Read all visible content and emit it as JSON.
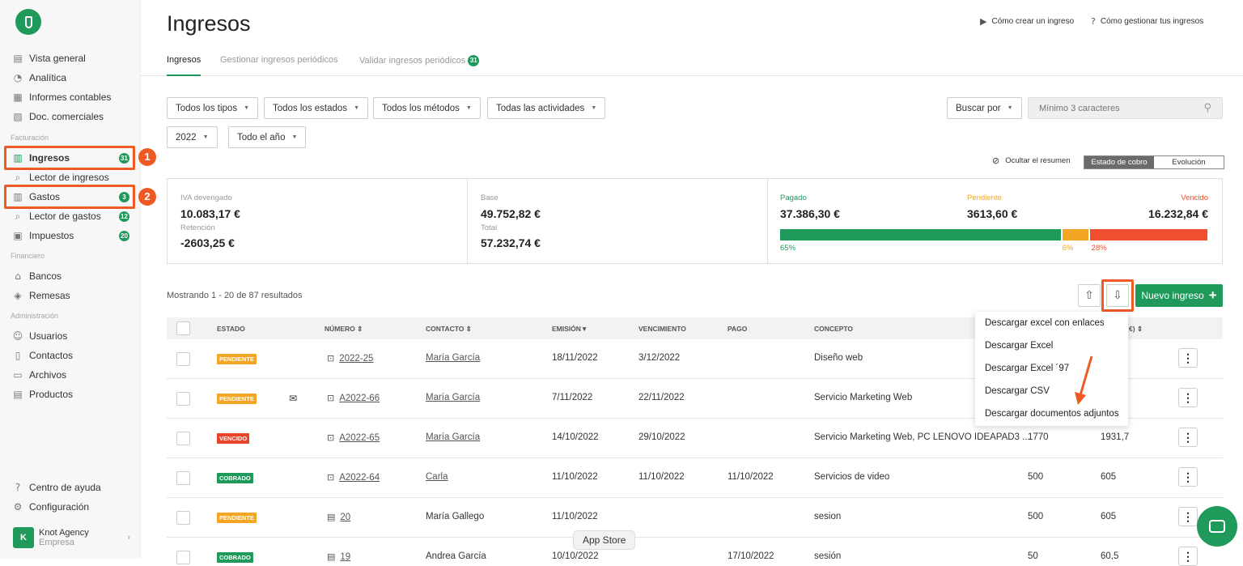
{
  "sidebar": {
    "nav_top": [
      {
        "label": "Vista general",
        "icon": "chart-icon"
      },
      {
        "label": "Analítica",
        "icon": "pie-icon"
      },
      {
        "label": "Informes contables",
        "icon": "report-icon"
      },
      {
        "label": "Doc. comerciales",
        "icon": "doc-icon"
      }
    ],
    "section_facturacion": "Facturación",
    "nav_facturacion": [
      {
        "label": "Ingresos",
        "badge": "31"
      },
      {
        "label": "Lector de ingresos",
        "badge": ""
      },
      {
        "label": "Gastos",
        "badge": "3"
      },
      {
        "label": "Lector de gastos",
        "badge": "12"
      },
      {
        "label": "Impuestos",
        "badge": "20"
      }
    ],
    "section_financiero": "Financiero",
    "nav_financiero": [
      {
        "label": "Bancos"
      },
      {
        "label": "Remesas"
      }
    ],
    "section_admin": "Administración",
    "nav_admin": [
      {
        "label": "Usuarios"
      },
      {
        "label": "Contactos"
      },
      {
        "label": "Archivos"
      },
      {
        "label": "Productos"
      }
    ],
    "bottom": [
      {
        "label": "Centro de ayuda"
      },
      {
        "label": "Configuración"
      }
    ],
    "agency": {
      "avatar": "K",
      "name": "Knot Agency",
      "type": "Empresa"
    },
    "callouts": [
      "1",
      "2"
    ]
  },
  "header": {
    "title": "Ingresos",
    "help_links": [
      "Cómo crear un ingreso",
      "Cómo gestionar tus ingresos"
    ]
  },
  "tabs": [
    {
      "label": "Ingresos"
    },
    {
      "label": "Gestionar ingresos periódicos"
    },
    {
      "label": "Validar ingresos periódicos",
      "badge": "31"
    }
  ],
  "filters": {
    "tipos": "Todos los tipos",
    "estados": "Todos los estados",
    "metodos": "Todos los métodos",
    "actividades": "Todas las actividades",
    "year": "2022",
    "period": "Todo el año",
    "buscar_por": "Buscar por",
    "search_placeholder": "Mínimo 3 caracteres"
  },
  "summary_controls": {
    "hide": "Ocultar el resumen",
    "seg_on": "Estado de cobro",
    "seg_off": "Evolución"
  },
  "summary": {
    "iva_label": "IVA devengado",
    "iva_value": "10.083,17 €",
    "ret_label": "Retención",
    "ret_value": "-2603,25 €",
    "base_label": "Base",
    "base_value": "49.752,82 €",
    "total_label": "Total",
    "total_value": "57.232,74 €",
    "pagado_label": "Pagado",
    "pagado_value": "37.386,30 €",
    "pagado_pct": "65%",
    "pagado_frac": 0.65,
    "pend_label": "Pendiente",
    "pend_value": "3613,60 €",
    "pend_pct": "6%",
    "pend_frac": 0.06,
    "venc_label": "Vencido",
    "venc_value": "16.232,84 €",
    "venc_pct": "28%",
    "venc_frac": 0.28,
    "colors": {
      "pagado": "#1f9a5a",
      "pendiente": "#f5a524",
      "vencido": "#f04e2f"
    }
  },
  "list": {
    "showing": "Mostrando 1 - 20 de 87 resultados",
    "new_button": "Nuevo ingreso"
  },
  "table": {
    "headers": {
      "estado": "ESTADO",
      "numero": "NÚMERO",
      "contacto": "CONTACTO",
      "emision": "EMISIÓN",
      "vencimiento": "VENCIMIENTO",
      "pago": "PAGO",
      "concepto": "CONCEPTO",
      "hidden_tail": "€)"
    },
    "rows": [
      {
        "estado": "PENDIENTE",
        "numero": "2022-25",
        "contacto": "María García",
        "emision": "18/11/2022",
        "vencimiento": "3/12/2022",
        "pago": "",
        "concepto": "Diseño web",
        "base": "",
        "total": ""
      },
      {
        "estado": "PENDIENTE",
        "numero": "A2022-66",
        "contacto": "María García",
        "emision": "7/11/2022",
        "vencimiento": "22/11/2022",
        "pago": "",
        "concepto": "Servicio Marketing Web",
        "base": "",
        "total": ""
      },
      {
        "estado": "VENCIDO",
        "numero": "A2022-65",
        "contacto": "María García",
        "emision": "14/10/2022",
        "vencimiento": "29/10/2022",
        "pago": "",
        "concepto": "Servicio Marketing Web, PC LENOVO IDEAPAD3 ...",
        "base": "1770",
        "total": "1931,7"
      },
      {
        "estado": "COBRADO",
        "numero": "A2022-64",
        "contacto": "Carla",
        "emision": "11/10/2022",
        "vencimiento": "11/10/2022",
        "pago": "11/10/2022",
        "concepto": "Servicios de video",
        "base": "500",
        "total": "605"
      },
      {
        "estado": "PENDIENTE",
        "numero": "20",
        "contacto": "María Gallego",
        "emision": "11/10/2022",
        "vencimiento": "",
        "pago": "",
        "concepto": "sesion",
        "base": "500",
        "total": "605"
      },
      {
        "estado": "COBRADO",
        "numero": "19",
        "contacto": "Andrea García",
        "emision": "10/10/2022",
        "vencimiento": "",
        "pago": "17/10/2022",
        "concepto": "sesión",
        "base": "50",
        "total": "60,5"
      }
    ]
  },
  "download_menu": [
    "Descargar excel con enlaces",
    "Descargar Excel",
    "Descargar Excel ´97",
    "Descargar CSV",
    "Descargar documentos adjuntos"
  ],
  "tooltip": "App Store",
  "colors": {
    "accent": "#1f9a5a",
    "highlight": "#ef5a24"
  }
}
